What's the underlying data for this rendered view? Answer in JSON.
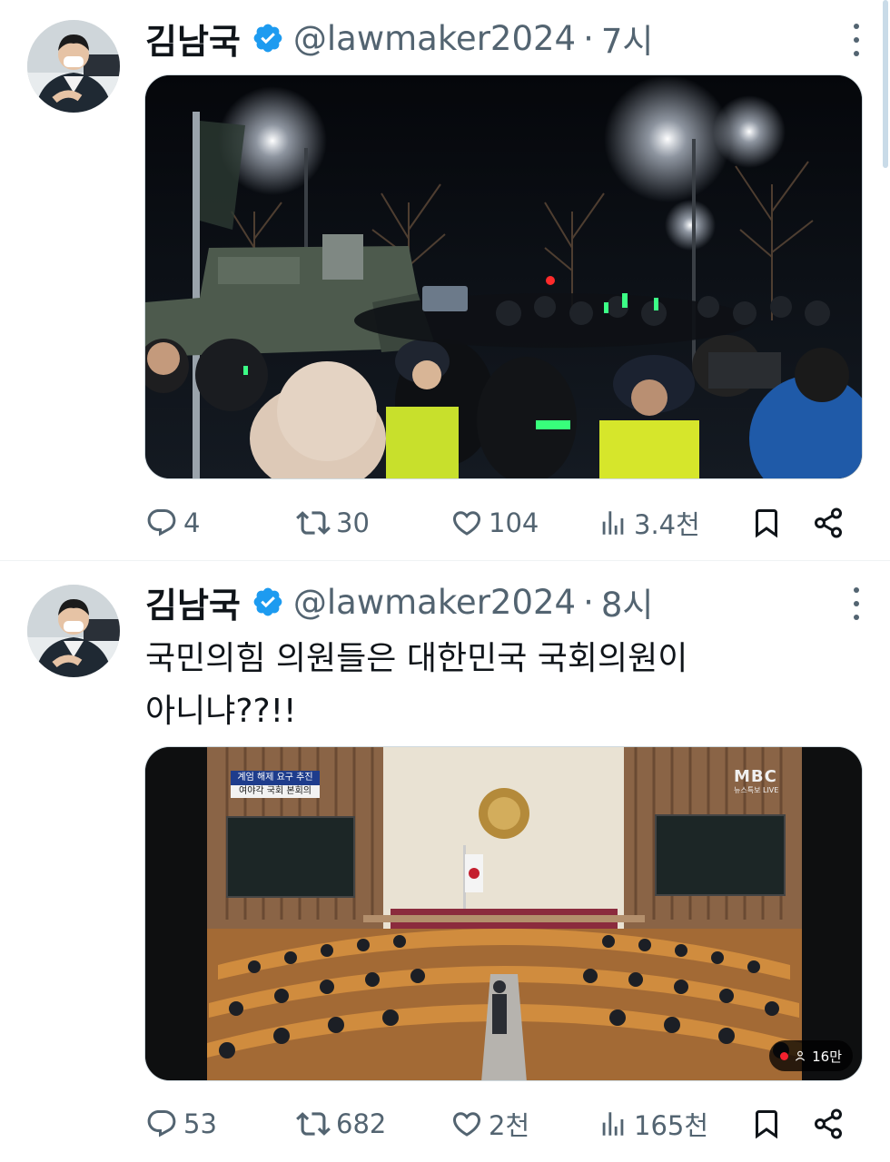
{
  "tweets": [
    {
      "author": {
        "name": "김남국",
        "handle": "@lawmaker2024",
        "verified": true
      },
      "time": "7시",
      "text": "",
      "media": {
        "type": "photo",
        "icon": "photo-icon"
      },
      "stats": {
        "replies": "4",
        "retweets": "30",
        "likes": "104",
        "views": "3.4천"
      }
    },
    {
      "author": {
        "name": "김남국",
        "handle": "@lawmaker2024",
        "verified": true
      },
      "time": "8시",
      "text": "국민의힘 의원들은 대한민국 국회의원이\n아니냐??!!",
      "media": {
        "type": "video",
        "view_count": "16만",
        "broadcast": {
          "caption_top": "계엄 해제 요구 추진",
          "caption_bottom": "여야각 국회 본회의",
          "logo": "MBC",
          "logo_sub": "뉴스특보 LIVE"
        }
      },
      "stats": {
        "replies": "53",
        "retweets": "682",
        "likes": "2천",
        "views": "165천"
      }
    }
  ],
  "colors": {
    "text_primary": "#0f1419",
    "text_secondary": "#536471",
    "verified_blue": "#1d9bf0",
    "divider": "#eff3f4"
  },
  "separator": "·"
}
